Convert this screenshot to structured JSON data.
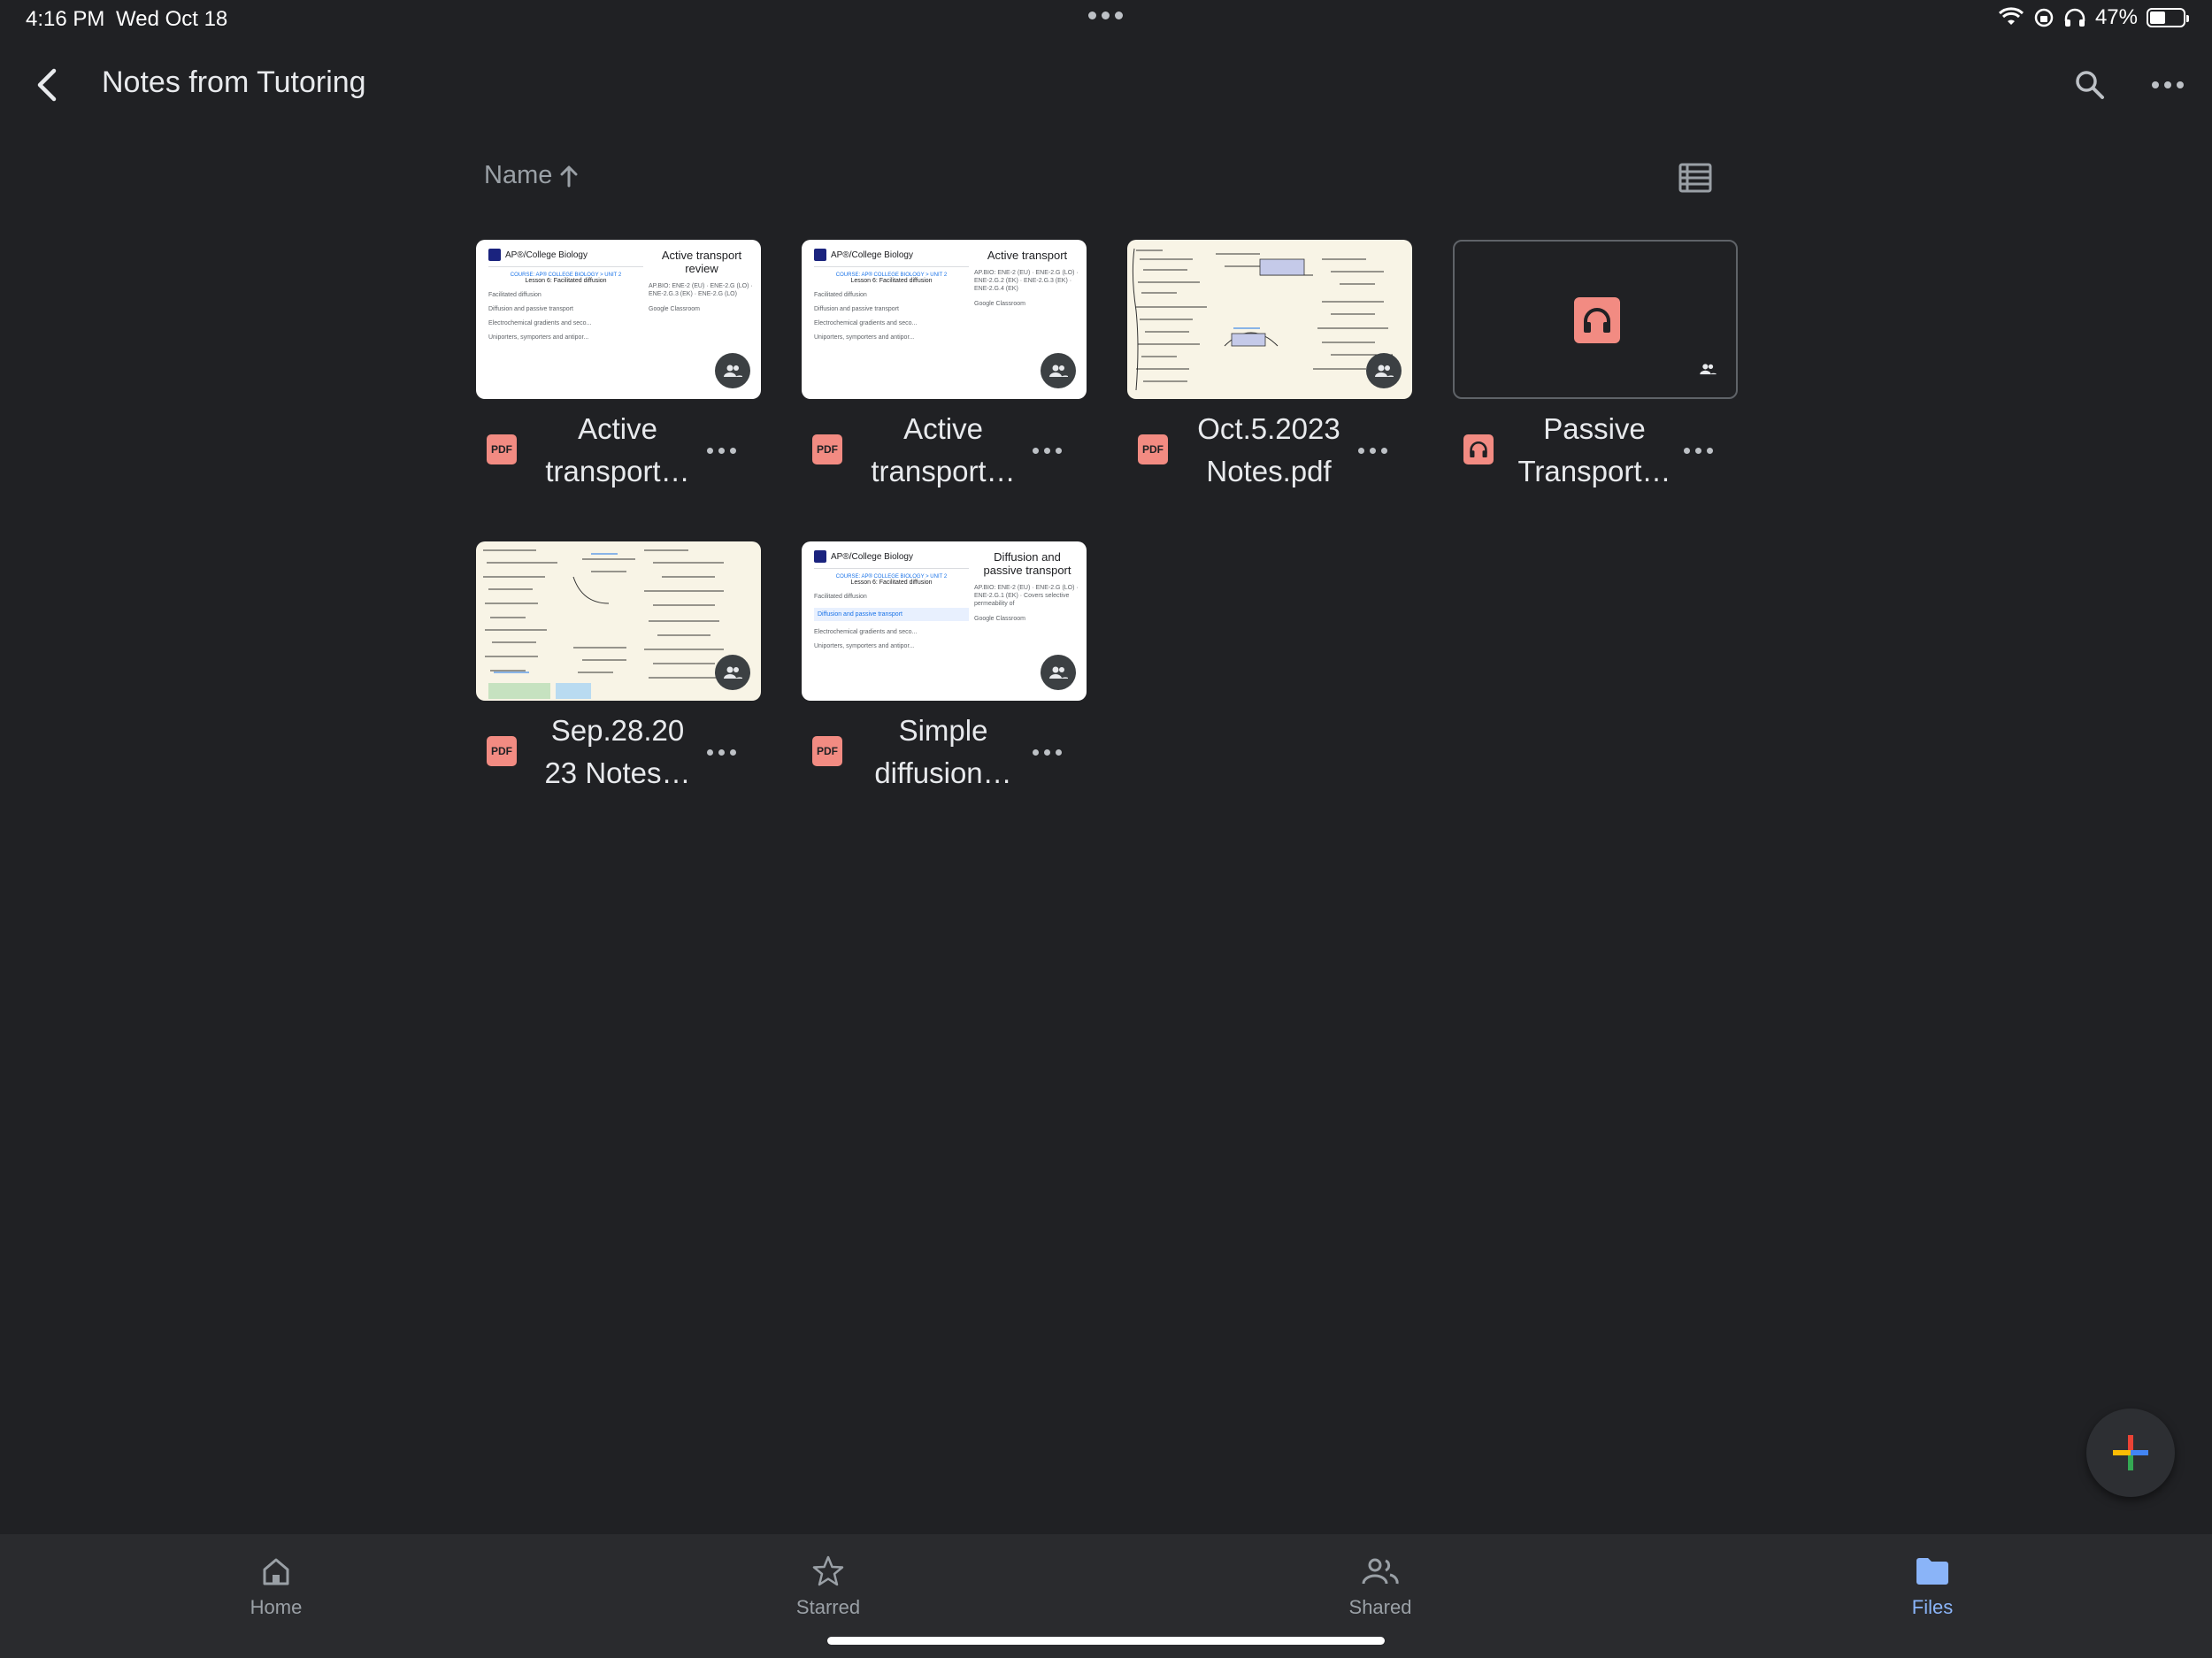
{
  "status_bar": {
    "time": "4:16 PM",
    "date": "Wed Oct 18",
    "battery": "47%",
    "battery_level": 0.47
  },
  "app_bar": {
    "title": "Notes from Tutoring"
  },
  "sort": {
    "label": "Name"
  },
  "files": [
    {
      "name_line1": "Active",
      "name_line2": "transport…",
      "type": "PDF",
      "preview": {
        "brand": "AP®/College Biology",
        "course": "COURSE: AP® COLLEGE BIOLOGY > UNIT 2",
        "lesson": "Lesson 6: Facilitated diffusion",
        "items": [
          "Facilitated diffusion",
          "Diffusion and passive transport",
          "Electrochemical gradients and seco...",
          "Uniporters, symporters and antipor..."
        ],
        "title": "Active transport review",
        "meta": "AP.BIO: ENE‑2 (EU) · ENE‑2.G (LO) · ENE‑2.G.3 (EK) · ENE‑2.G (LO)",
        "classroom": "Google Classroom"
      }
    },
    {
      "name_line1": "Active",
      "name_line2": "transport…",
      "type": "PDF",
      "preview": {
        "brand": "AP®/College Biology",
        "course": "COURSE: AP® COLLEGE BIOLOGY > UNIT 2",
        "lesson": "Lesson 6: Facilitated diffusion",
        "items": [
          "Facilitated diffusion",
          "Diffusion and passive transport",
          "Electrochemical gradients and seco...",
          "Uniporters, symporters and antipor..."
        ],
        "title": "Active transport",
        "meta": "AP.BIO: ENE‑2 (EU) · ENE‑2.G (LO) · ENE‑2.G.2 (EK) · ENE‑2.G.3 (EK) · ENE‑2.G.4 (EK)",
        "classroom": "Google Classroom"
      }
    },
    {
      "name_line1": "Oct.5.2023",
      "name_line2": "Notes.pdf",
      "type": "PDF"
    },
    {
      "name_line1": "Passive",
      "name_line2": "Transport…",
      "type": "audio"
    },
    {
      "name_line1": "Sep.28.20",
      "name_line2": "23 Notes…",
      "type": "PDF"
    },
    {
      "name_line1": "Simple",
      "name_line2": "diffusion…",
      "type": "PDF",
      "preview": {
        "brand": "AP®/College Biology",
        "course": "COURSE: AP® COLLEGE BIOLOGY > UNIT 2",
        "lesson": "Lesson 6: Facilitated diffusion",
        "items": [
          "Facilitated diffusion",
          "Diffusion and passive transport",
          "Electrochemical gradients and seco...",
          "Uniporters, symporters and antipor..."
        ],
        "title": "Diffusion and passive transport",
        "meta": "AP.BIO: ENE‑2 (EU) · ENE‑2.G (LO) · ENE‑2.G.1 (EK) · Covers selective permeability of",
        "classroom": "Google Classroom"
      }
    }
  ],
  "bottom_nav": {
    "items": [
      {
        "label": "Home"
      },
      {
        "label": "Starred"
      },
      {
        "label": "Shared"
      },
      {
        "label": "Files"
      }
    ]
  },
  "colors": {
    "background": "#202124",
    "accent": "#8ab4f8",
    "pdf_red": "#f28b82"
  }
}
